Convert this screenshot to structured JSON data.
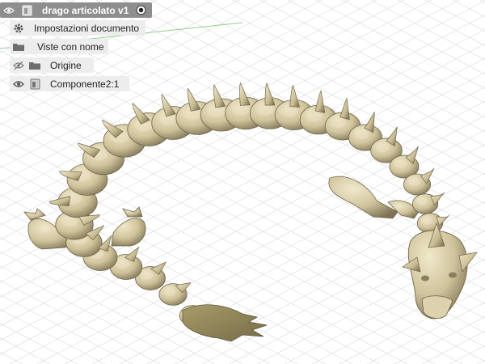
{
  "browser": {
    "root": {
      "label": "drago articolato v1",
      "visible": true,
      "active": true
    },
    "items": [
      {
        "label": "Impostazioni documento",
        "icon": "gear-icon",
        "visible": null
      },
      {
        "label": "Viste con nome",
        "icon": "folder-icon",
        "visible": null
      },
      {
        "label": "Origine",
        "icon": "folder-icon",
        "visible": false
      },
      {
        "label": "Componente2:1",
        "icon": "component-icon",
        "visible": true
      }
    ]
  },
  "colors": {
    "model_fill": "#cfc39b",
    "model_shadow": "#7d7254",
    "model_highlight": "#ece3c4",
    "grid": "#e2e2e2",
    "axis_green": "#8fcf8f",
    "panel_root": "#8e8e8e"
  }
}
